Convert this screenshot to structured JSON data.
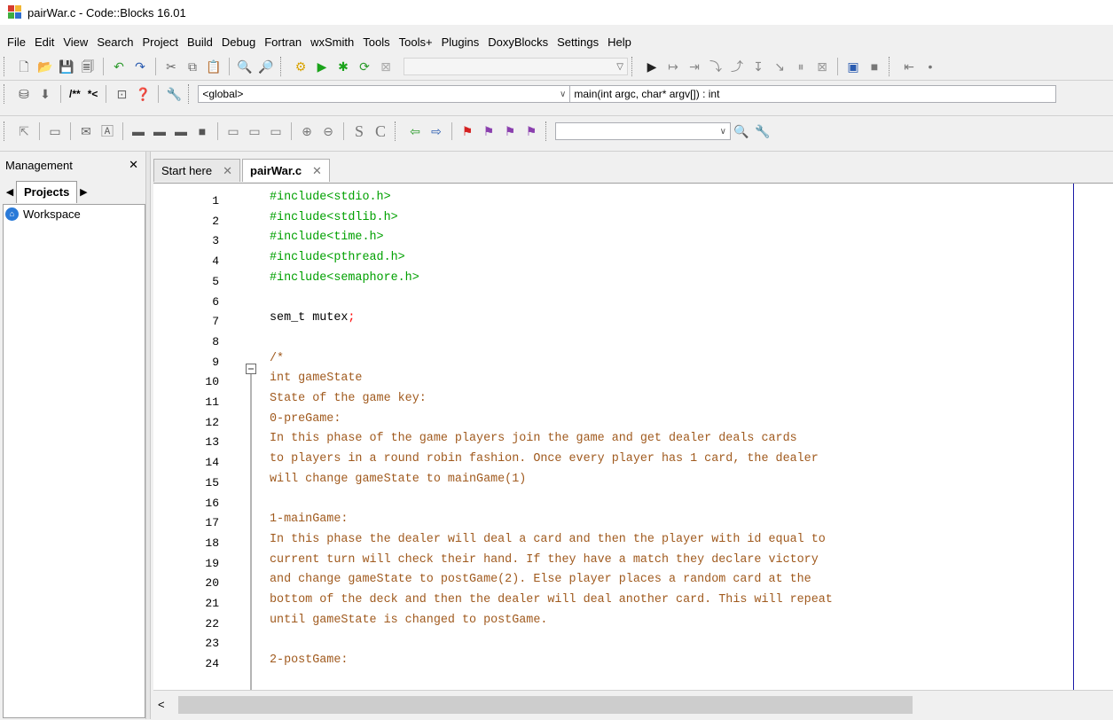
{
  "window": {
    "title": "pairWar.c - Code::Blocks 16.01"
  },
  "menu": [
    "File",
    "Edit",
    "View",
    "Search",
    "Project",
    "Build",
    "Debug",
    "Fortran",
    "wxSmith",
    "Tools",
    "Tools+",
    "Plugins",
    "DoxyBlocks",
    "Settings",
    "Help"
  ],
  "toolbar": {
    "build_target_value": "",
    "scope_value": "<global>",
    "function_value": "main(int argc, char* argv[]) : int",
    "search_value": "",
    "doc_block_label": "/**",
    "doc_line_label": "*<",
    "s_label": "S",
    "c_label": "C"
  },
  "management": {
    "title": "Management",
    "close": "✕",
    "tab_label": "Projects",
    "workspace_label": "Workspace"
  },
  "tabs": [
    {
      "label": "Start here",
      "close": "✕"
    },
    {
      "label": "pairWar.c",
      "close": "✕"
    }
  ],
  "editor": {
    "line_numbers": [
      "1",
      "2",
      "3",
      "4",
      "5",
      "6",
      "7",
      "8",
      "9",
      "10",
      "11",
      "12",
      "13",
      "14",
      "15",
      "16",
      "17",
      "18",
      "19",
      "20",
      "21",
      "22",
      "23",
      "24"
    ],
    "lines": [
      "#include<stdio.h>",
      "#include<stdlib.h>",
      "#include<time.h>",
      "#include<pthread.h>",
      "#include<semaphore.h>",
      "",
      "sem_t mutex;",
      "",
      "/*",
      "int gameState",
      "State of the game key:",
      "0-preGame:",
      "In this phase of the game players join the game and get dealer deals cards",
      "to players in a round robin fashion. Once every player has 1 card, the dealer",
      "will change gameState to mainGame(1)",
      "",
      "1-mainGame:",
      "In this phase the dealer will deal a card and then the player with id equal to",
      "current turn will check their hand. If they have a match they declare victory",
      "and change gameState to postGame(2). Else player places a random card at the",
      "bottom of the deck and then the dealer will deal another card. This will repeat",
      "until gameState is changed to postGame.",
      "",
      "2-postGame:"
    ]
  },
  "colors": {
    "preprocessor": "#00a000",
    "comment": "#a05a1e",
    "operator": "#ff0000",
    "edge": "#1a1aa6"
  }
}
